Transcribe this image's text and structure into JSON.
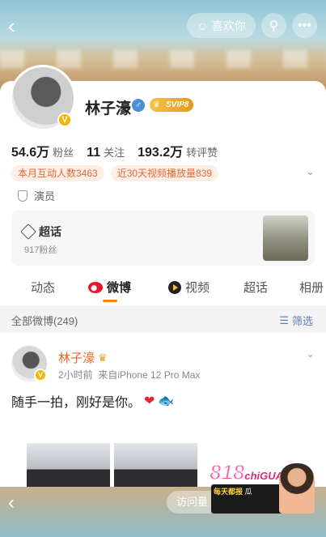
{
  "header": {
    "like_label": "喜欢你",
    "back_icon": "chevron-left-icon",
    "search_icon": "search-icon",
    "more_icon": "more-icon"
  },
  "profile": {
    "name": "林子濠",
    "vip_label": "SVIP8",
    "verified_badge": "V",
    "stats": [
      {
        "num": "54.6万",
        "label": "粉丝"
      },
      {
        "num": "11",
        "label": "关注"
      },
      {
        "num": "193.2万",
        "label": "转评赞"
      }
    ],
    "tags": [
      "本月互动人数3463",
      "近30天视频播放量839"
    ],
    "role": "演员"
  },
  "chaohua": {
    "title": "超话",
    "fans": "917粉丝"
  },
  "tabs": [
    {
      "label": "动态"
    },
    {
      "label": "微博"
    },
    {
      "label": "视频"
    },
    {
      "label": "超话"
    },
    {
      "label": "相册"
    }
  ],
  "filter": {
    "all_label": "全部微博(249)",
    "filter_label": "筛选"
  },
  "post": {
    "name": "林子濠",
    "time": "2小时前",
    "source": "来自iPhone 12 Pro Max",
    "text": "随手一拍，刚好是你。"
  },
  "bottom": {
    "visits_label": "访问量 2"
  },
  "ad": {
    "logo_main": "818",
    "logo_sub": "chiGUA",
    "banner_line1": "每天都报",
    "banner_line2": "瓜"
  },
  "colors": {
    "accent": "#ff8200",
    "name_orange": "#e86b1f",
    "tag_bg": "#fdeee6",
    "tag_text": "#e06b3a",
    "vip_gold": "#e09b1a"
  }
}
